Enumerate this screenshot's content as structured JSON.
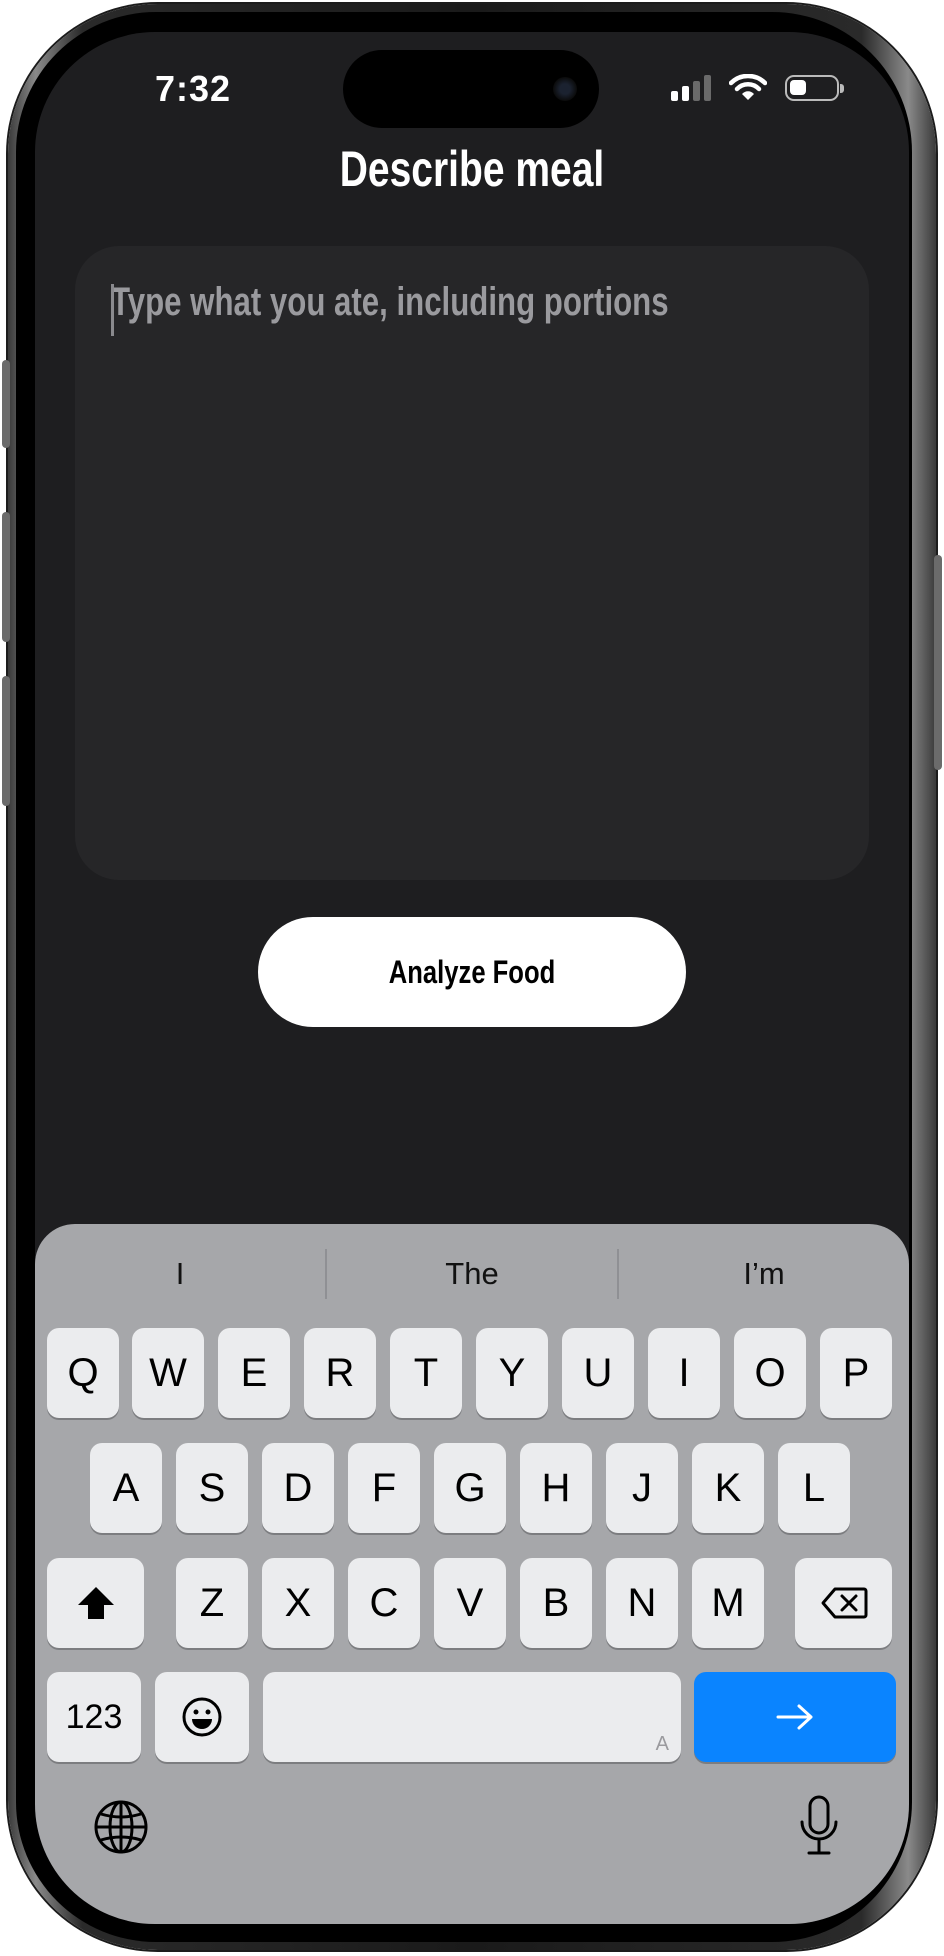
{
  "status_bar": {
    "time": "7:32"
  },
  "page": {
    "title": "Describe meal",
    "input_placeholder": "Type what you ate, including portions",
    "analyze_button_label": "Analyze Food"
  },
  "keyboard": {
    "suggestions": [
      "I",
      "The",
      "I’m"
    ],
    "row1": [
      "Q",
      "W",
      "E",
      "R",
      "T",
      "Y",
      "U",
      "I",
      "O",
      "P"
    ],
    "row2": [
      "A",
      "S",
      "D",
      "F",
      "G",
      "H",
      "J",
      "K",
      "L"
    ],
    "row3": [
      "Z",
      "X",
      "C",
      "V",
      "B",
      "N",
      "M"
    ],
    "numbers_label": "123",
    "space_hint": "A",
    "icons": [
      "shift-icon",
      "backspace-icon",
      "emoji-icon",
      "return-arrow-icon",
      "globe-icon",
      "microphone-icon"
    ]
  },
  "colors": {
    "background": "#1e1e20",
    "input_background": "#262628",
    "return_key": "#0a84ff",
    "keyboard_background": "#a6a7aa"
  }
}
